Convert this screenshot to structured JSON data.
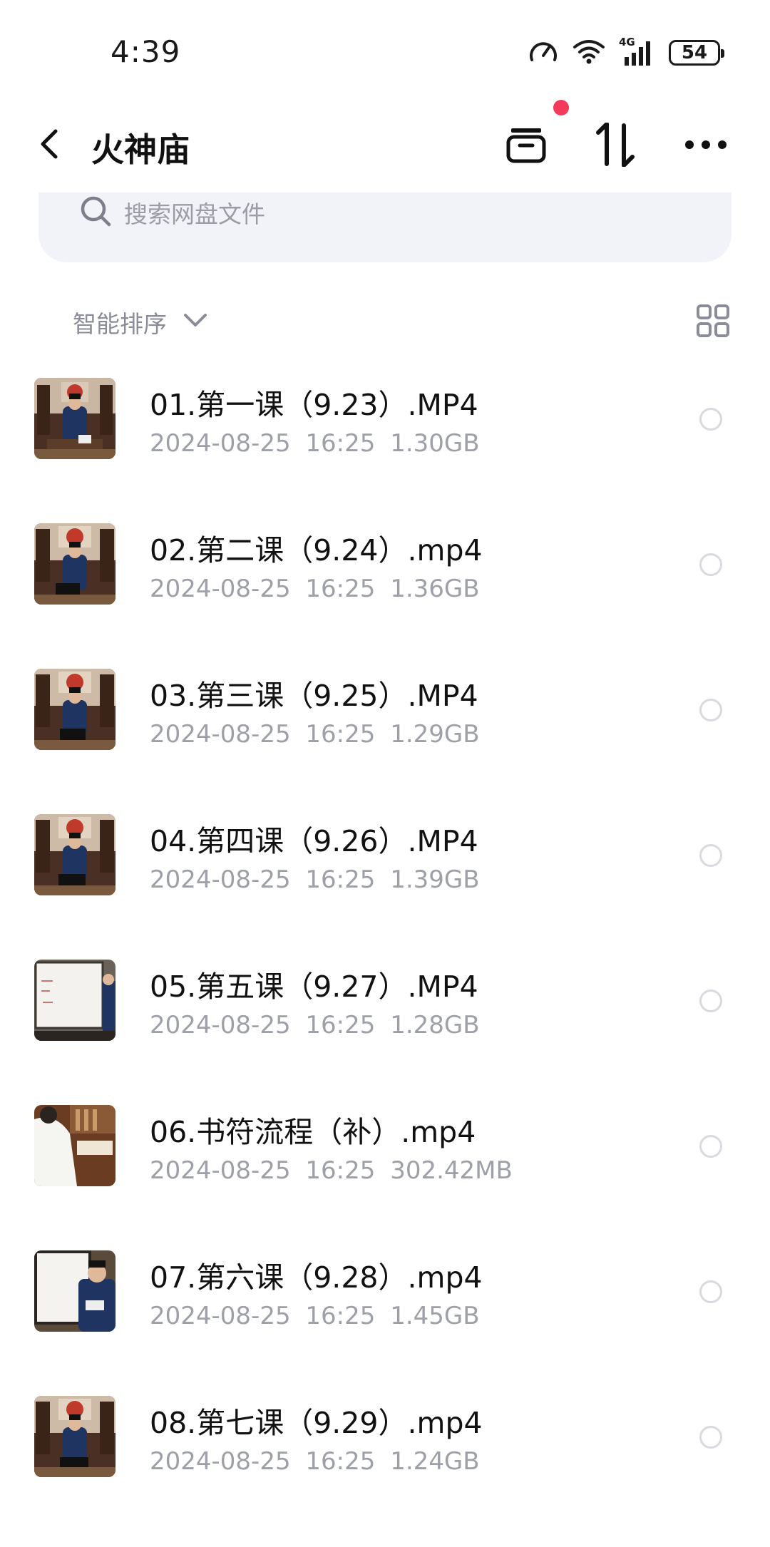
{
  "status_bar": {
    "time": "4:39",
    "network": "4G",
    "battery": "54"
  },
  "header": {
    "title": "火神庙",
    "icons": [
      "back-icon",
      "inbox-icon",
      "sort-icon",
      "more-icon"
    ],
    "notification_dot_color": "#f43a5a"
  },
  "search": {
    "placeholder": "搜索网盘文件"
  },
  "sort": {
    "label": "智能排序"
  },
  "colors": {
    "accent": "#f43a5a",
    "muted_text": "#9ea0a8",
    "search_bg": "#f2f3f8"
  },
  "files": [
    {
      "name": "01.第一课（9.23）.MP4",
      "date": "2024-08-25",
      "time": "16:25",
      "size": "1.30GB"
    },
    {
      "name": "02.第二课（9.24）.mp4",
      "date": "2024-08-25",
      "time": "16:25",
      "size": "1.36GB"
    },
    {
      "name": "03.第三课（9.25）.MP4",
      "date": "2024-08-25",
      "time": "16:25",
      "size": "1.29GB"
    },
    {
      "name": "04.第四课（9.26）.MP4",
      "date": "2024-08-25",
      "time": "16:25",
      "size": "1.39GB"
    },
    {
      "name": "05.第五课（9.27）.MP4",
      "date": "2024-08-25",
      "time": "16:25",
      "size": "1.28GB"
    },
    {
      "name": "06.书符流程（补）.mp4",
      "date": "2024-08-25",
      "time": "16:25",
      "size": "302.42MB"
    },
    {
      "name": "07.第六课（9.28）.mp4",
      "date": "2024-08-25",
      "time": "16:25",
      "size": "1.45GB"
    },
    {
      "name": "08.第七课（9.29）.mp4",
      "date": "2024-08-25",
      "time": "16:25",
      "size": "1.24GB"
    }
  ]
}
